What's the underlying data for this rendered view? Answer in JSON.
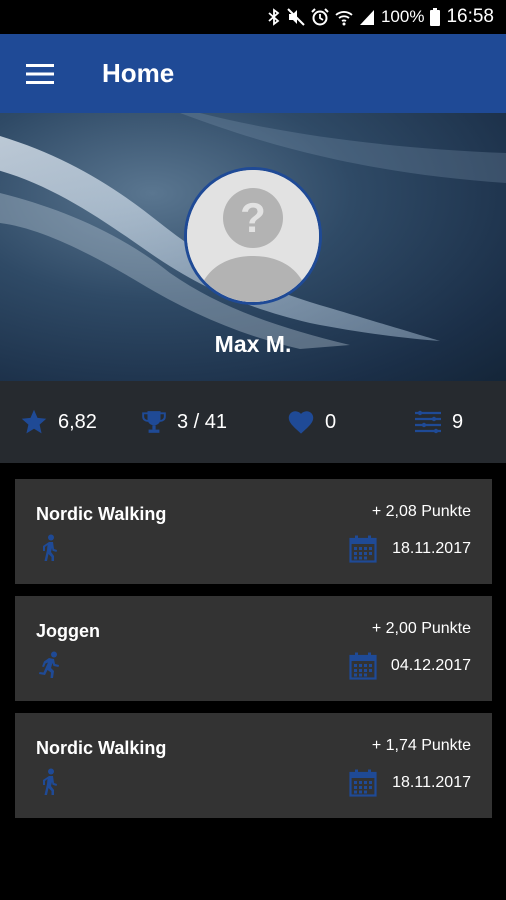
{
  "status_bar": {
    "battery": "100%",
    "time": "16:58",
    "icons": [
      "bluetooth-icon",
      "mute-icon",
      "alarm-icon",
      "wifi-icon",
      "signal-icon",
      "battery-icon"
    ]
  },
  "app_bar": {
    "title": "Home",
    "menu_icon": "hamburger-menu-icon"
  },
  "profile": {
    "name": "Max M.",
    "avatar_icon": "unknown-user-avatar-icon"
  },
  "stats": [
    {
      "icon": "star-icon",
      "value": "6,82"
    },
    {
      "icon": "trophy-icon",
      "value": "3 / 41"
    },
    {
      "icon": "heart-icon",
      "value": "0"
    },
    {
      "icon": "activity-list-icon",
      "value": "9"
    }
  ],
  "activities": [
    {
      "title": "Nordic Walking",
      "points": "+ 2,08 Punkte",
      "date": "18.11.2017",
      "icon": "walking-icon"
    },
    {
      "title": "Joggen",
      "points": "+ 2,00 Punkte",
      "date": "04.12.2017",
      "icon": "running-icon"
    },
    {
      "title": "Nordic Walking",
      "points": "+ 1,74 Punkte",
      "date": "18.11.2017",
      "icon": "walking-icon"
    }
  ],
  "colors": {
    "primary": "#1f4a96",
    "icon_blue": "#1f4a96",
    "card_bg": "#333333",
    "stats_bg": "#262a2f",
    "background": "#000000"
  }
}
